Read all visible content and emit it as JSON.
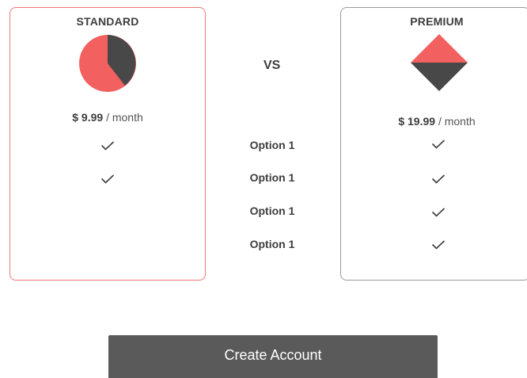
{
  "comparison": {
    "vs_label": "VS",
    "options": [
      "Option 1",
      "Option 1",
      "Option 1",
      "Option 1"
    ]
  },
  "plans": {
    "standard": {
      "name": "STANDARD",
      "price": "$ 9.99",
      "period": "/ month",
      "graphic_icon": "pie-chart-icon",
      "included_checks": 2,
      "border_color": "#f07676"
    },
    "premium": {
      "name": "PREMIUM",
      "price": "$ 19.99",
      "period": "/ month",
      "graphic_icon": "diamond-icon",
      "included_checks": 4,
      "border_color": "#9a9a9a"
    }
  },
  "icons": {
    "check": "check-icon"
  },
  "cta": {
    "label": "Create Account"
  },
  "colors": {
    "accent": "#f26060",
    "dark": "#4a4a4a",
    "button_bg": "#5a5a5a"
  }
}
